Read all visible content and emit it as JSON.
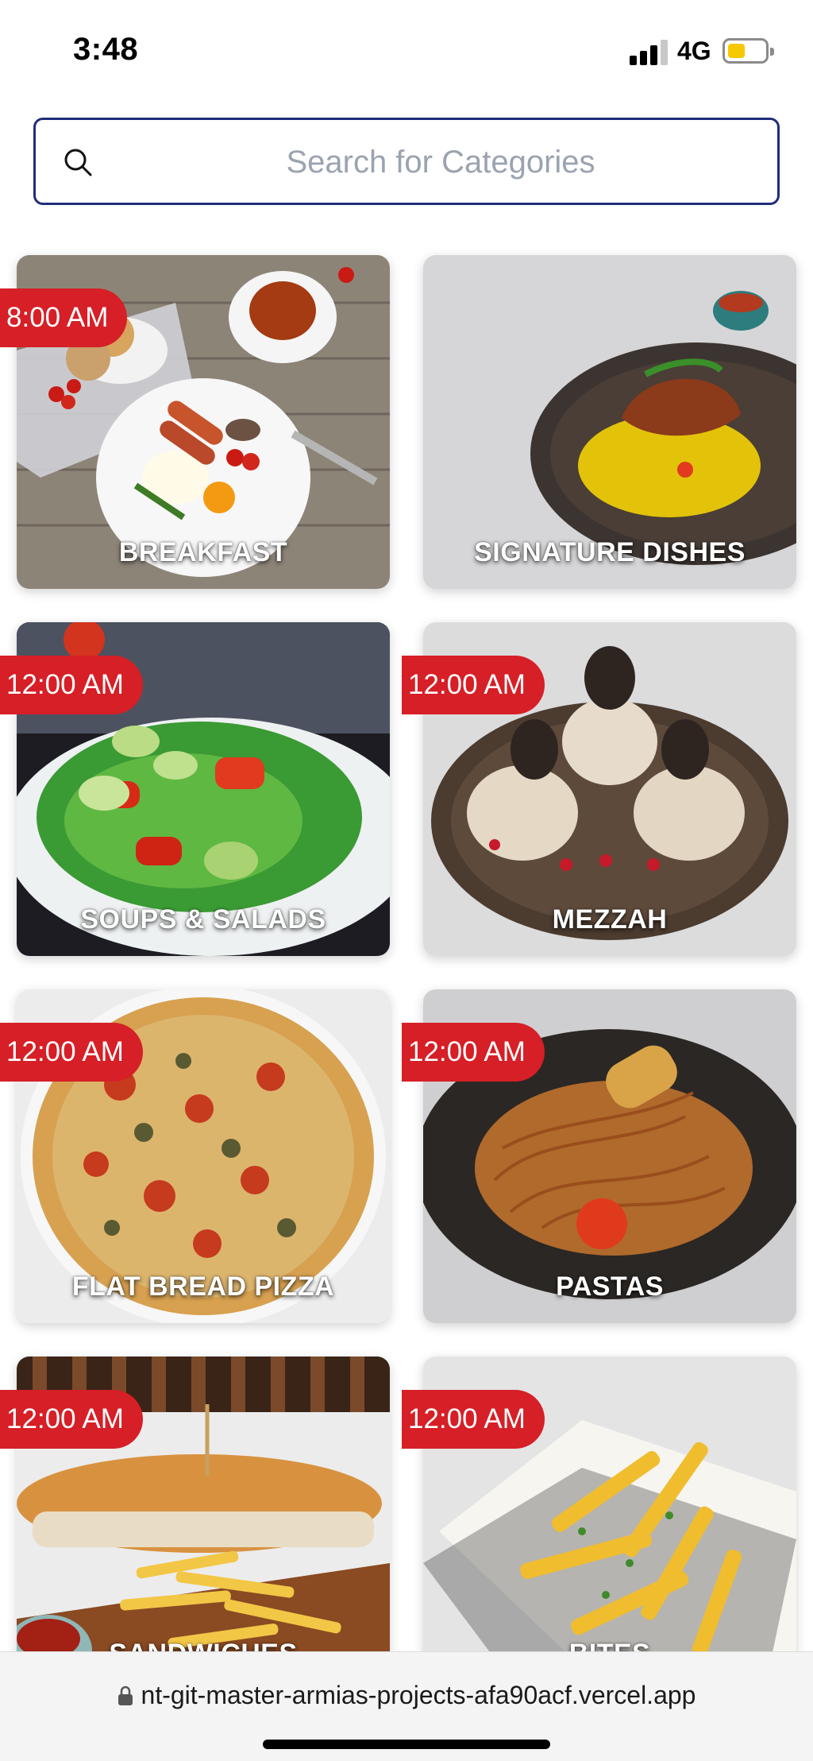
{
  "status_bar": {
    "time": "3:48",
    "network": "4G",
    "battery_color": "#f5c800"
  },
  "search": {
    "placeholder": "Search for Categories"
  },
  "categories": [
    {
      "name": "BREAKFAST",
      "time": "8:00 AM"
    },
    {
      "name": "SIGNATURE DISHES",
      "time": ""
    },
    {
      "name": "SOUPS & SALADS",
      "time": "12:00 AM"
    },
    {
      "name": "MEZZAH",
      "time": "12:00 AM"
    },
    {
      "name": "FLAT BREAD PIZZA",
      "time": "12:00 AM"
    },
    {
      "name": "PASTAS",
      "time": "12:00 AM"
    },
    {
      "name": "SANDWICHES",
      "time": "12:00 AM"
    },
    {
      "name": "BITES",
      "time": "12:00 AM"
    }
  ],
  "browser": {
    "url": "nt-git-master-armias-projects-afa90acf.vercel.app"
  },
  "colors": {
    "accent": "#d61f26",
    "search_border": "#1f2d7a"
  }
}
